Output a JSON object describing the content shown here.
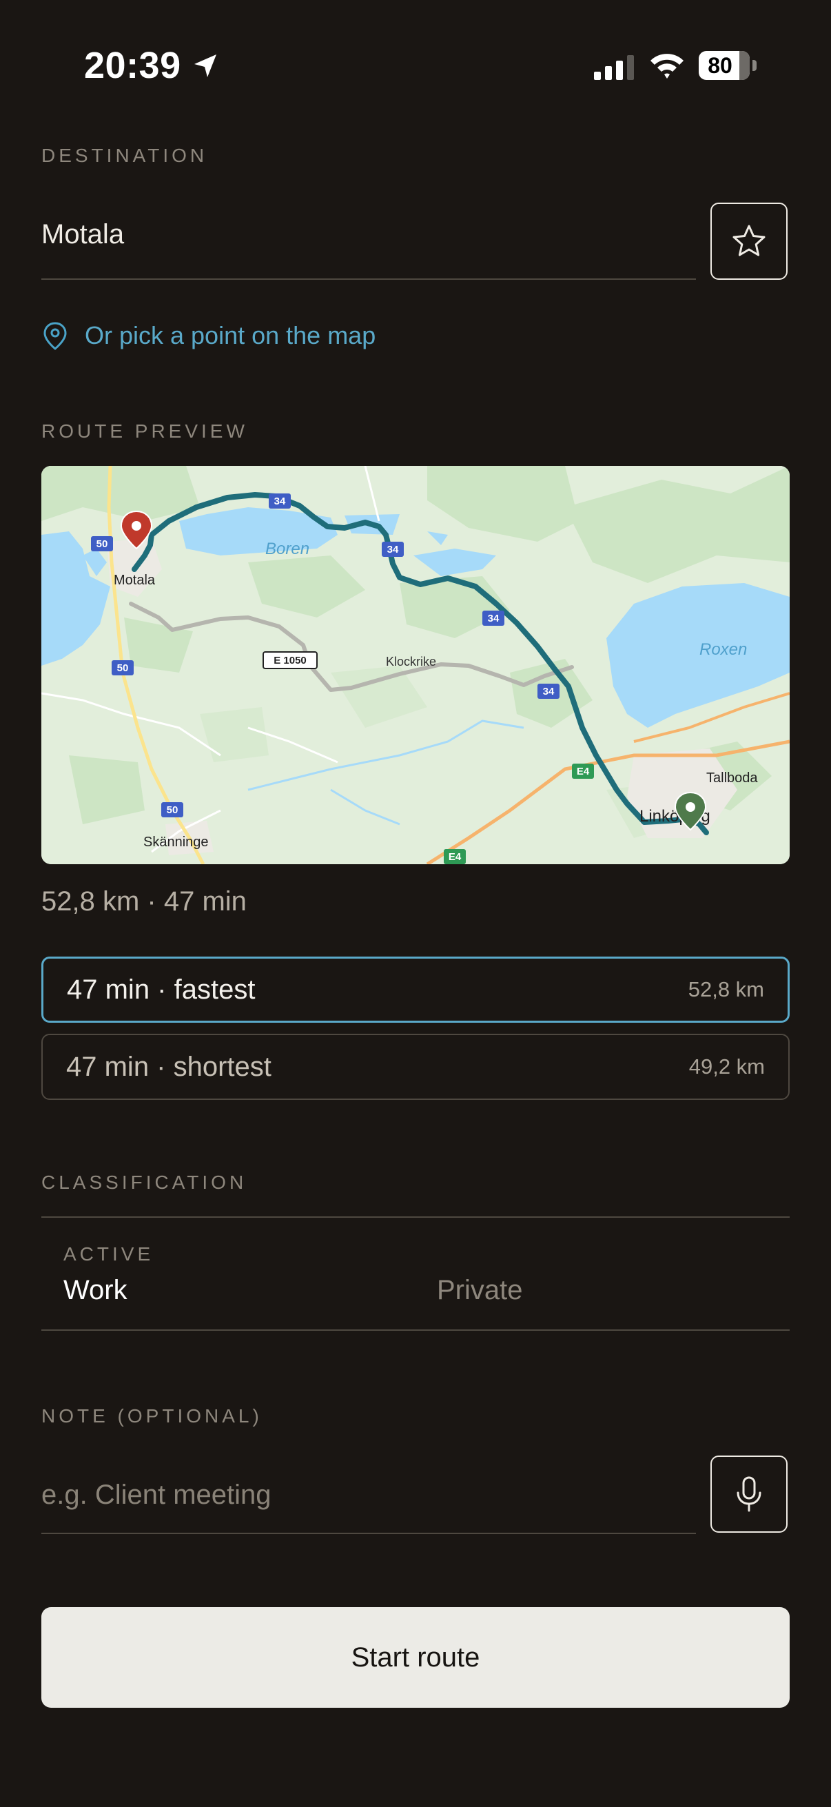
{
  "status_bar": {
    "time": "20:39",
    "battery_level": "80",
    "battery_fraction": 0.8
  },
  "destination": {
    "section_label": "DESTINATION",
    "value": "Motala",
    "favorite_icon": "star-icon",
    "pick_on_map_icon": "location-pin-icon",
    "pick_on_map_label": "Or pick a point on the map"
  },
  "route_preview": {
    "section_label": "ROUTE PREVIEW",
    "map": {
      "places": {
        "motala": "Motala",
        "boren": "Boren",
        "roxen": "Roxen",
        "klockrike": "Klockrike",
        "tallboda": "Tallboda",
        "linkoping": "Linköping",
        "skanninge": "Skänninge"
      },
      "road_labels": {
        "r50a": "50",
        "r50b": "50",
        "r50c": "50",
        "r34a": "34",
        "r34b": "34",
        "r34c": "34",
        "r34d": "34",
        "e1050": "E 1050",
        "e4a": "E4",
        "e4b": "E4"
      },
      "colors": {
        "route": "#1f6d7a",
        "alt_route": "#b5b5ae",
        "water": "#a6daf9",
        "start_pin": "#c0392b",
        "end_pin": "#4f7a4b"
      }
    },
    "summary": "52,8 km · 47 min",
    "options": [
      {
        "label": "47 min · fastest",
        "distance": "52,8 km",
        "selected": true
      },
      {
        "label": "47 min · shortest",
        "distance": "49,2 km",
        "selected": false
      }
    ]
  },
  "classification": {
    "section_label": "CLASSIFICATION",
    "active_label": "ACTIVE",
    "options": [
      "Work",
      "Private"
    ],
    "active": "Work"
  },
  "note": {
    "section_label": "NOTE (OPTIONAL)",
    "placeholder": "e.g. Client meeting",
    "value": "",
    "mic_icon": "microphone-icon"
  },
  "start_button": {
    "label": "Start route"
  }
}
